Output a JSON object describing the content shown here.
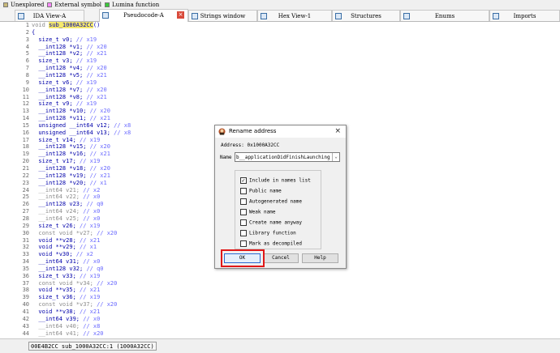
{
  "legend": [
    {
      "label": "Unexplored",
      "color": "#c8b878"
    },
    {
      "label": "External symbol",
      "color": "#ff88ff"
    },
    {
      "label": "Lumina function",
      "color": "#3bc83b"
    }
  ],
  "tabs": [
    {
      "label": "IDA View-A",
      "active": false
    },
    {
      "label": "Pseudocode-A",
      "active": true
    },
    {
      "label": "Strings window",
      "active": false
    },
    {
      "label": "Hex View-1",
      "active": false
    },
    {
      "label": "Structures",
      "active": false
    },
    {
      "label": "Enums",
      "active": false
    },
    {
      "label": "Imports",
      "active": false
    }
  ],
  "code": {
    "signature_prefix": "void ",
    "signature_name": "sub_1000A32CC",
    "signature_suffix": "()",
    "lines": [
      {
        "n": "2",
        "code": "{",
        "comment": ""
      },
      {
        "n": "3",
        "code": "  size_t v0; ",
        "comment": "// x19"
      },
      {
        "n": "4",
        "code": "  __int128 *v1; ",
        "comment": "// x20"
      },
      {
        "n": "5",
        "code": "  __int128 *v2; ",
        "comment": "// x21"
      },
      {
        "n": "6",
        "code": "  size_t v3; ",
        "comment": "// x19"
      },
      {
        "n": "7",
        "code": "  __int128 *v4; ",
        "comment": "// x20"
      },
      {
        "n": "8",
        "code": "  __int128 *v5; ",
        "comment": "// x21"
      },
      {
        "n": "9",
        "code": "  size_t v6; ",
        "comment": "// x19"
      },
      {
        "n": "10",
        "code": "  __int128 *v7; ",
        "comment": "// x20"
      },
      {
        "n": "11",
        "code": "  __int128 *v8; ",
        "comment": "// x21"
      },
      {
        "n": "12",
        "code": "  size_t v9; ",
        "comment": "// x19"
      },
      {
        "n": "13",
        "code": "  __int128 *v10; ",
        "comment": "// x20"
      },
      {
        "n": "14",
        "code": "  __int128 *v11; ",
        "comment": "// x21"
      },
      {
        "n": "15",
        "code": "  unsigned __int64 v12; ",
        "comment": "// x8"
      },
      {
        "n": "16",
        "code": "  unsigned __int64 v13; ",
        "comment": "// x8"
      },
      {
        "n": "17",
        "code": "  size_t v14; ",
        "comment": "// x19"
      },
      {
        "n": "18",
        "code": "  __int128 *v15; ",
        "comment": "// x20"
      },
      {
        "n": "19",
        "code": "  __int128 *v16; ",
        "comment": "// x21"
      },
      {
        "n": "20",
        "code": "  size_t v17; ",
        "comment": "// x19"
      },
      {
        "n": "21",
        "code": "  __int128 *v18; ",
        "comment": "// x20"
      },
      {
        "n": "22",
        "code": "  __int128 *v19; ",
        "comment": "// x21"
      },
      {
        "n": "23",
        "code": "  __int128 *v20; ",
        "comment": "// x1"
      },
      {
        "n": "24",
        "code": "  __int64 v21; ",
        "comment": "// x2"
      },
      {
        "n": "25",
        "code": "  __int64 v22; ",
        "comment": "// x0"
      },
      {
        "n": "26",
        "code": "  __int128 v23; ",
        "comment": "// q0"
      },
      {
        "n": "27",
        "code": "  __int64 v24; ",
        "comment": "// x0"
      },
      {
        "n": "28",
        "code": "  __int64 v25; ",
        "comment": "// x0"
      },
      {
        "n": "29",
        "code": "  size_t v26; ",
        "comment": "// x19"
      },
      {
        "n": "30",
        "code": "  const void *v27; ",
        "comment": "// x20"
      },
      {
        "n": "31",
        "code": "  void **v28; ",
        "comment": "// x21"
      },
      {
        "n": "32",
        "code": "  void **v29; ",
        "comment": "// x1"
      },
      {
        "n": "33",
        "code": "  void *v30; ",
        "comment": "// x2"
      },
      {
        "n": "34",
        "code": "  __int64 v31; ",
        "comment": "// x0"
      },
      {
        "n": "35",
        "code": "  __int128 v32; ",
        "comment": "// q0"
      },
      {
        "n": "36",
        "code": "  size_t v33; ",
        "comment": "// x19"
      },
      {
        "n": "37",
        "code": "  const void *v34; ",
        "comment": "// x20"
      },
      {
        "n": "38",
        "code": "  void **v35; ",
        "comment": "// x21"
      },
      {
        "n": "39",
        "code": "  size_t v36; ",
        "comment": "// x19"
      },
      {
        "n": "40",
        "code": "  const void *v37; ",
        "comment": "// x20"
      },
      {
        "n": "41",
        "code": "  void **v38; ",
        "comment": "// x21"
      },
      {
        "n": "42",
        "code": "  __int64 v39; ",
        "comment": "// x0"
      },
      {
        "n": "43",
        "code": "  __int64 v40; ",
        "comment": "// x8"
      },
      {
        "n": "44",
        "code": "  __int64 v41; ",
        "comment": "// x20"
      }
    ]
  },
  "status": {
    "text": "00E4B2CC sub_1000A32CC:1 (1000A32CC)"
  },
  "dialog": {
    "title": "Rename address",
    "close": "×",
    "address_label": "Address: 0x1000A32CC",
    "name_label": "Name",
    "name_value": "b__applicationDidFinishLaunching",
    "options": [
      {
        "label": "Include in names list",
        "checked": true
      },
      {
        "label": "Public name",
        "checked": false
      },
      {
        "label": "Autogenerated name",
        "checked": false
      },
      {
        "label": "Weak name",
        "checked": false
      },
      {
        "label": "Create name anyway",
        "checked": false
      },
      {
        "label": "Library function",
        "checked": false
      },
      {
        "label": "Mark as decompiled",
        "checked": false
      }
    ],
    "ok_label": "OK",
    "cancel_label": "Cancel",
    "help_label": "Help",
    "checkmark": "✓",
    "dropdown_glyph": "⌄"
  }
}
